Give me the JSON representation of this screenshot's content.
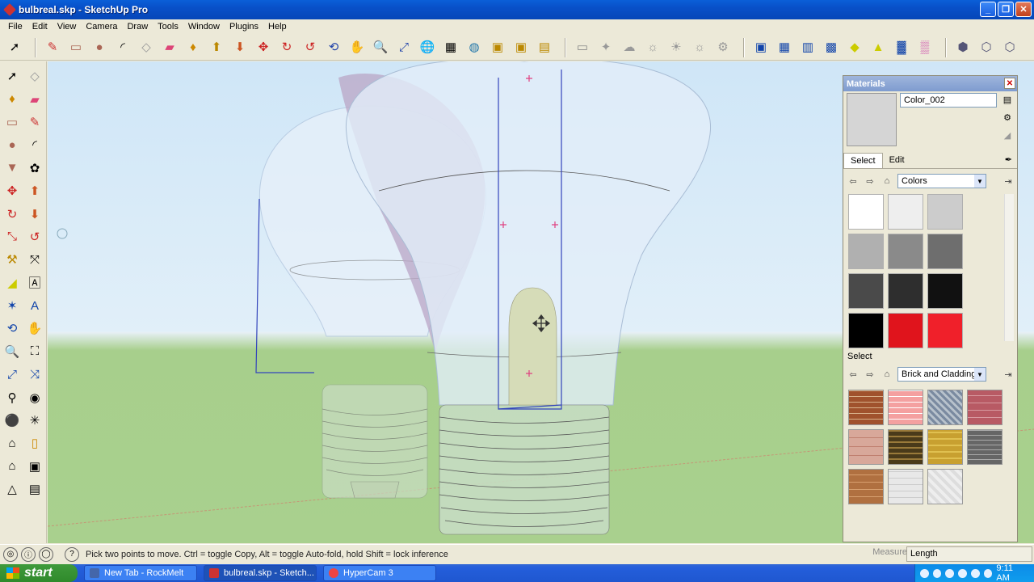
{
  "window": {
    "title": "bulbreal.skp - SketchUp Pro",
    "minimize": "_",
    "maximize": "❐",
    "close": "✕"
  },
  "menu": [
    "File",
    "Edit",
    "View",
    "Camera",
    "Draw",
    "Tools",
    "Window",
    "Plugins",
    "Help"
  ],
  "toolbar_icons": [
    "select-icon",
    "pencil-icon",
    "rectangle-icon",
    "circle-icon",
    "arc-icon",
    "eraser-icon",
    "paint-bucket-icon",
    "push-pull-icon",
    "follow-me-icon",
    "move-icon",
    "rotate-icon",
    "offset-icon",
    "orbit-icon",
    "pan-icon",
    "zoom-icon",
    "zoom-extents-icon",
    "get-models-icon",
    "share-model-icon",
    "google-earth-icon",
    "components-icon",
    "warehouse-icon",
    "upload-icon",
    "sandbox-icon",
    "section-plane-icon",
    "shadow-icon",
    "fog-icon",
    "style-icon",
    "xray-icon",
    "wireframe-icon",
    "hidden-line-icon",
    "shaded-icon",
    "textured-icon",
    "monochrome-icon",
    "iso-view-icon",
    "top-view-icon",
    "front-view-icon"
  ],
  "left_tools": [
    "select-icon",
    "make-component-icon",
    "paint-bucket-icon",
    "eraser-icon",
    "rectangle-icon",
    "line-icon",
    "circle-icon",
    "arc-icon",
    "polygon-icon",
    "freehand-icon",
    "move-icon",
    "push-pull-icon",
    "rotate-icon",
    "follow-me-icon",
    "scale-icon",
    "offset-icon",
    "tape-measure-icon",
    "dimension-icon",
    "protractor-icon",
    "text-icon",
    "axes-icon",
    "3d-text-icon",
    "orbit-icon",
    "pan-icon",
    "zoom-icon",
    "zoom-window-icon",
    "zoom-extents-icon",
    "previous-view-icon",
    "walk-icon",
    "look-around-icon",
    "position-camera-icon",
    "section-plane-icon",
    "home-icon",
    "box-icon",
    "house-icon",
    "window-icon",
    "roof-icon",
    "stairs-icon"
  ],
  "materials": {
    "title": "Materials",
    "close": "✕",
    "current_name": "Color_002",
    "tab_select": "Select",
    "tab_edit": "Edit",
    "library1": "Colors",
    "section2_label": "Select",
    "library2": "Brick and Cladding",
    "colors": [
      "#ffffff",
      "#eeeeee",
      "#cccccc",
      "#b0b0b0",
      "#8a8a8a",
      "#6e6e6e",
      "#4a4a4a",
      "#2e2e2e",
      "#111111",
      "#000000",
      "#e0141c",
      "#f0202a"
    ],
    "accent_preview": "#d5d5d5"
  },
  "status": {
    "hint": "Pick two points to move.  Ctrl = toggle Copy, Alt = toggle Auto-fold, hold Shift = lock inference",
    "measure_label": "Measurements",
    "vcb_label": "Length"
  },
  "taskbar": {
    "start": "start",
    "tasks": [
      "New Tab - RockMelt",
      "bulbreal.skp - Sketch...",
      "HyperCam 3"
    ],
    "clock": "9:11 AM"
  }
}
